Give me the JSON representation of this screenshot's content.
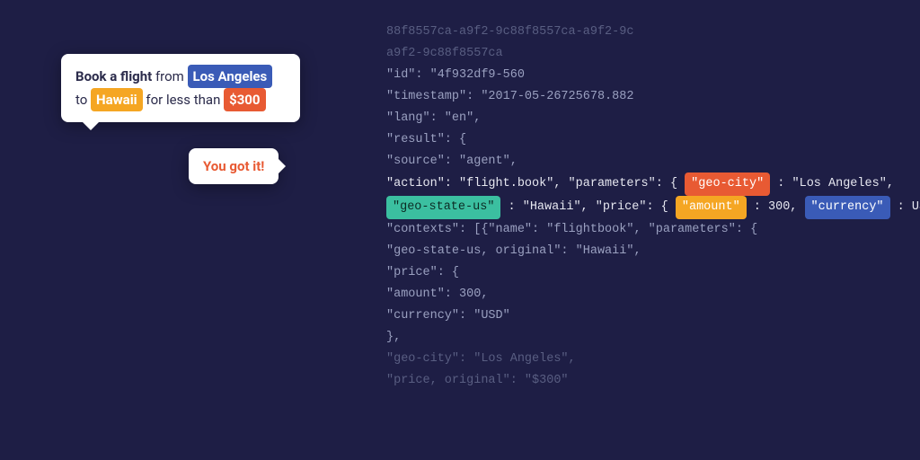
{
  "chat": {
    "user": {
      "t1": "Book a flight",
      "t2": " from ",
      "chip_la": "Los Angeles",
      "t3": "to ",
      "chip_hi": "Hawaii",
      "t4": " for less than ",
      "chip_price": "$300"
    },
    "bot": {
      "reply": "You got it!"
    }
  },
  "code": {
    "l01": "88f8557ca-a9f2-9c88f8557ca-a9f2-9c",
    "l02": "a9f2-9c88f8557ca",
    "l03": "\"id\": \"4f932df9-560",
    "l04": "\"timestamp\": \"2017-05-26725678.882",
    "l05": "\"lang\": \"en\",",
    "l06": "\"result\": {",
    "l07": "\"source\": \"agent\",",
    "l08_a": "\"action\": \"flight.book\", \"parameters\": {",
    "l08_tag": "\"geo-city\"",
    "l08_b": ": \"Los Angeles\",",
    "l09_tag1": "\"geo-state-us\"",
    "l09_a": ": \"Hawaii\", \"price\": {",
    "l09_tag2": "\"amount\"",
    "l09_b": ": 300, ",
    "l09_tag3": "\"currency\"",
    "l09_c": ": USD},",
    "l10": "\"contexts\": [{\"name\": \"flightbook\", \"parameters\": {",
    "l11": "\"geo-state-us, original\": \"Hawaii\",",
    "l12": "\"price\": {",
    "l13": "\"amount\": 300,",
    "l14": "\"currency\": \"USD\"",
    "l15": "},",
    "l16": "\"geo-city\": \"Los Angeles\",",
    "l17": "\"price, original\": \"$300\""
  }
}
